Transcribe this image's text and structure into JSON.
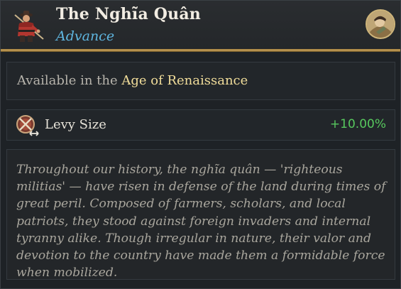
{
  "header": {
    "title": "The Nghĩa Quân",
    "subtitle": "Advance",
    "unit_icon": "militia-soldier-icon",
    "badge_icon": "civilization-leader-portrait-icon"
  },
  "availability": {
    "prefix": "Available in the",
    "age": "Age of Renaissance"
  },
  "stat": {
    "icon": "levy-size-icon",
    "label": "Levy Size",
    "value": "+10.00%"
  },
  "description": "Throughout our history, the nghĩa quân — 'righteous militias' — have risen in defense of the land during times of great peril. Composed of farmers, scholars, and local patriots, they stood against foreign invaders and internal tyranny alike. Though irregular in nature, their valor and devotion to the country have made them a formidable force when mobilized.",
  "colors": {
    "title": "#f1ece2",
    "subtitle": "#5fb6e0",
    "age_highlight": "#f1dd9a",
    "positive_value": "#57c85e",
    "header_rule": "#c9a25a"
  }
}
